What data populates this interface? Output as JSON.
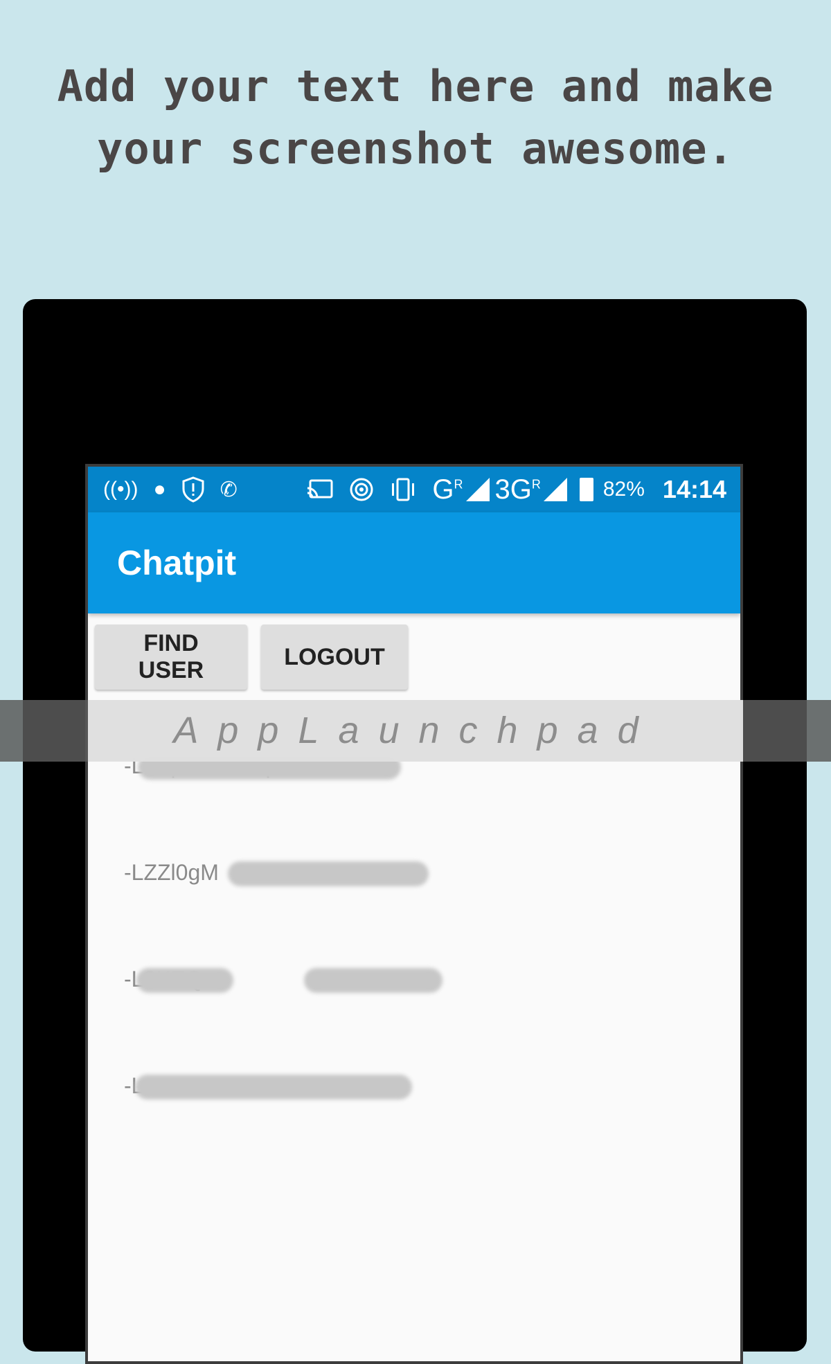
{
  "promo": {
    "line1": "Add your text here and make",
    "line2": "your screenshot awesome."
  },
  "status_bar": {
    "network1": "G",
    "network1_sup": "R",
    "network2": "3G",
    "network2_sup": "R",
    "battery": "82%",
    "time": "14:14",
    "icons": [
      "hotspot-icon",
      "jio-icon",
      "shield-icon",
      "call-alert-icon",
      "cast-icon",
      "wifi-tether-icon",
      "vibrate-icon",
      "signal-icon",
      "signal-icon",
      "battery-icon"
    ]
  },
  "app_bar": {
    "title": "Chatpit"
  },
  "actions": {
    "find_user": "FIND USER",
    "logout": "LOGOUT"
  },
  "users": [
    {
      "id": "-LZZpEYL9uCpFZtv"
    },
    {
      "id": "-LZZl0gM"
    },
    {
      "id": "-L3KEQ"
    },
    {
      "id": "-L"
    }
  ],
  "watermark": "AppLaunchpad",
  "colors": {
    "background": "#cae6ec",
    "status_bar": "#0584c9",
    "app_bar": "#0997e2",
    "button": "#dedede"
  }
}
